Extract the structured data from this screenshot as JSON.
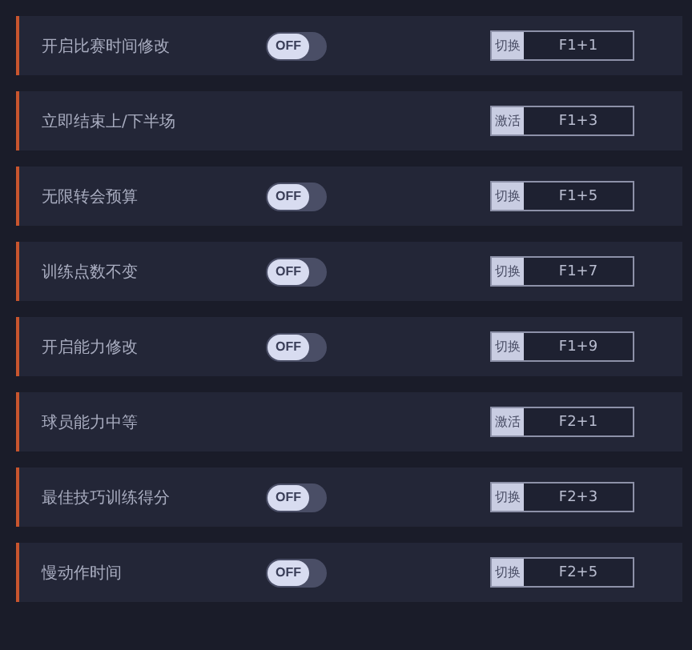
{
  "cheats": [
    {
      "kind": "toggle",
      "label": "开启比赛时间修改",
      "switch": {
        "on": false,
        "text": "OFF"
      },
      "action": "切换",
      "hotkey": "F1+1"
    },
    {
      "kind": "button",
      "label": "立即结束上/下半场",
      "action": "激活",
      "hotkey": "F1+3"
    },
    {
      "kind": "toggle",
      "label": "无限转会预算",
      "switch": {
        "on": false,
        "text": "OFF"
      },
      "action": "切换",
      "hotkey": "F1+5"
    },
    {
      "kind": "toggle",
      "label": "训练点数不变",
      "switch": {
        "on": false,
        "text": "OFF"
      },
      "action": "切换",
      "hotkey": "F1+7"
    },
    {
      "kind": "toggle",
      "label": "开启能力修改",
      "switch": {
        "on": false,
        "text": "OFF"
      },
      "action": "切换",
      "hotkey": "F1+9"
    },
    {
      "kind": "button",
      "label": "球员能力中等",
      "action": "激活",
      "hotkey": "F2+1"
    },
    {
      "kind": "toggle",
      "label": "最佳技巧训练得分",
      "switch": {
        "on": false,
        "text": "OFF"
      },
      "action": "切换",
      "hotkey": "F2+3"
    },
    {
      "kind": "toggle",
      "label": "慢动作时间",
      "switch": {
        "on": false,
        "text": "OFF"
      },
      "action": "切换",
      "hotkey": "F2+5"
    }
  ]
}
